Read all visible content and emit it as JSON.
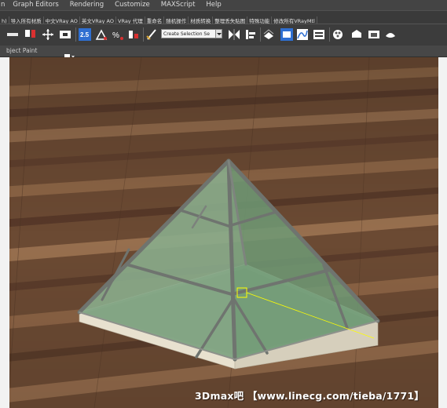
{
  "menu": {
    "items": [
      "n",
      "Graph Editors",
      "Rendering",
      "Customize",
      "MAXScript",
      "Help"
    ]
  },
  "plugin_toolbar": {
    "buttons": [
      "h)",
      "导入所有材质",
      "中文VRay AO",
      "英文VRay AO",
      "VRay 代理",
      "重命名",
      "随机操作",
      "材质转换",
      "整理丢失贴图",
      "特殊功能",
      "修改所有VRayMtl"
    ]
  },
  "main_toolbar": {
    "selection_set_placeholder": "Create Selection Se",
    "snap_label": "2.5",
    "icons": [
      "select-icon",
      "select-and-link-icon",
      "move-icon",
      "scale-icon",
      "snaps-toggle-icon",
      "angle-snap-icon",
      "percent-snap-icon",
      "spinner-snap-icon",
      "edit-named-selection-icon",
      "mirror-icon",
      "align-icon",
      "layers-icon",
      "graphite-toggle-icon",
      "curve-editor-icon",
      "schematic-view-icon",
      "material-editor-icon",
      "render-setup-icon",
      "rendered-frame-icon",
      "render-icon"
    ]
  },
  "ribbon": {
    "label": "bject Paint"
  },
  "viewport": {
    "watermark": "3Dmax吧 【www.linecg.com/tieba/1771】"
  },
  "colors": {
    "ui_dark": "#444444",
    "floor_wood": "#6b4a33",
    "glass_green": "#7fa383",
    "frame_grey": "#6f746f",
    "base_cream": "#e8e1cf",
    "selection_yellow": "#ffff00"
  }
}
